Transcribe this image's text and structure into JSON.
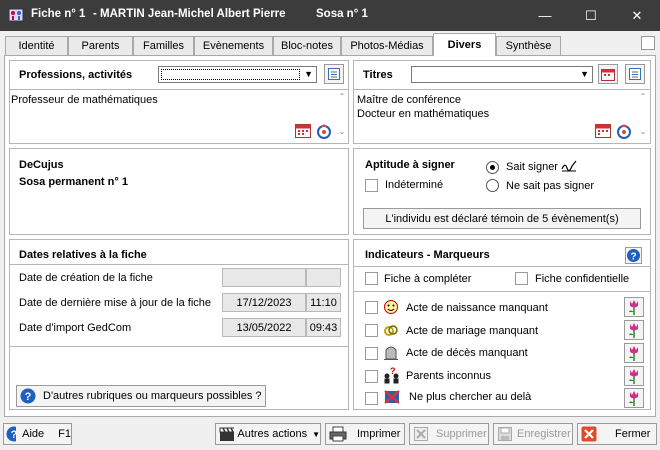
{
  "window": {
    "title_fiche": "Fiche n° 1",
    "title_name": "-  MARTIN Jean-Michel Albert Pierre",
    "title_sosa": "Sosa n°  1",
    "minimize": "—",
    "maximize": "☐",
    "close": "✕"
  },
  "tabs": [
    {
      "label": "Identité"
    },
    {
      "label": "Parents"
    },
    {
      "label": "Familles"
    },
    {
      "label": "Evènements"
    },
    {
      "label": "Bloc-notes"
    },
    {
      "label": "Photos-Médias"
    },
    {
      "label": "Divers"
    },
    {
      "label": "Synthèse"
    }
  ],
  "professions": {
    "title": "Professions, activités",
    "combo_value": "",
    "text": "Professeur de mathématiques"
  },
  "titres": {
    "title": "Titres",
    "combo_value": "",
    "lines": [
      "Maître de conférence",
      "Docteur en mathématiques"
    ]
  },
  "decujus": {
    "line1": "DeCujus",
    "line2": "Sosa permanent n° 1"
  },
  "aptitude": {
    "title": "Aptitude à signer",
    "indetermine": "Indéterminé",
    "sait_signer": "Sait signer",
    "ne_sait_pas": "Ne sait pas signer",
    "temoin_button": "L'individu est déclaré témoin de 5 évènement(s)"
  },
  "dates": {
    "title": "Dates relatives à la fiche",
    "creation_label": "Date de création de la fiche",
    "creation_date": "",
    "creation_time": "",
    "maj_label": "Date de dernière mise à jour de la fiche",
    "maj_date": "17/12/2023",
    "maj_time": "11:10",
    "import_label": "Date d'import GedCom",
    "import_date": "13/05/2022",
    "import_time": "09:43"
  },
  "autres_button": "D'autres rubriques ou marqueurs possibles ?",
  "indicateurs": {
    "title": "Indicateurs - Marqueurs",
    "fiche_completer": "Fiche à compléter",
    "fiche_confidentielle": "Fiche confidentielle",
    "items": [
      {
        "label": "Acte de naissance manquant"
      },
      {
        "label": "Acte de mariage manquant"
      },
      {
        "label": "Acte de décès manquant"
      },
      {
        "label": "Parents inconnus"
      },
      {
        "label": "Ne plus chercher au delà"
      }
    ]
  },
  "footer": {
    "aide": "Aide",
    "aide_key": "F1",
    "autres_actions": "Autres actions",
    "imprimer": "Imprimer",
    "supprimer": "Supprimer",
    "enregistrer": "Enregistrer",
    "fermer": "Fermer"
  },
  "colors": {
    "titlebar": "#3c3c3c",
    "help_blue": "#1f5fbf",
    "close_red": "#e04a2a"
  }
}
